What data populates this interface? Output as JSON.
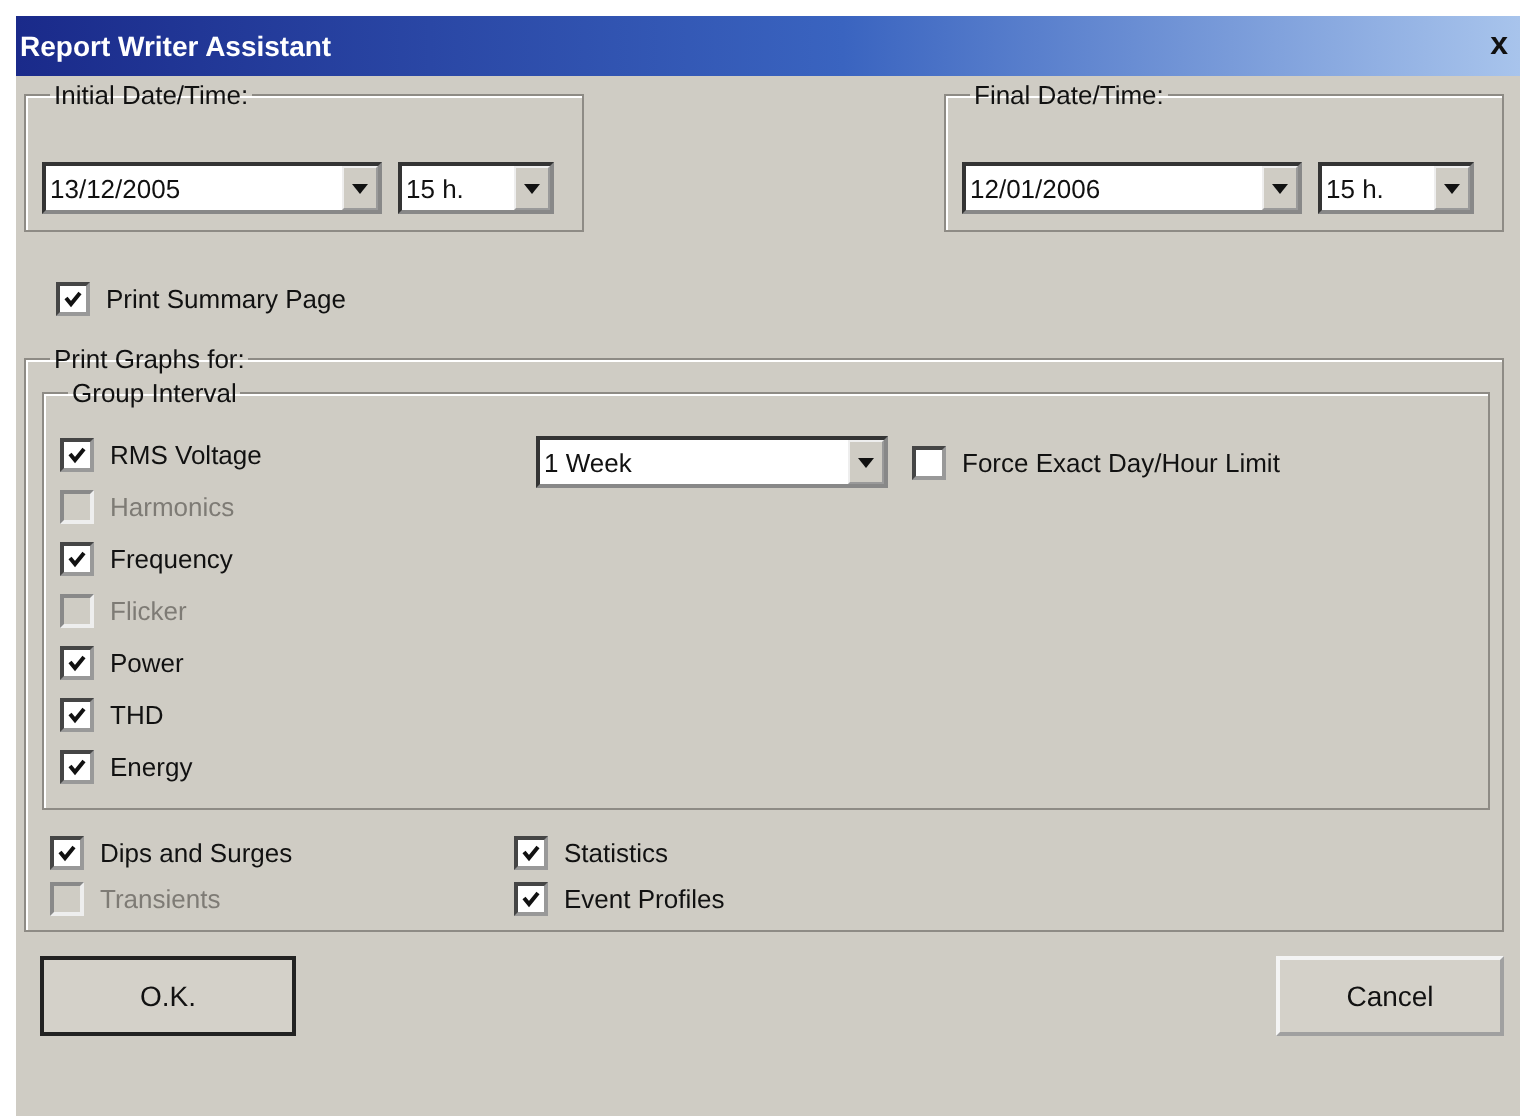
{
  "window": {
    "title": "Report Writer Assistant",
    "close": "x"
  },
  "initial": {
    "label": "Initial Date/Time:",
    "date": "13/12/2005",
    "hour": "15 h."
  },
  "final": {
    "label": "Final Date/Time:",
    "date": "12/01/2006",
    "hour": "15 h."
  },
  "summary": {
    "label": "Print Summary Page",
    "checked": true,
    "disabled": false
  },
  "graphs": {
    "label": "Print Graphs for:",
    "group": {
      "label": "Group Interval",
      "interval": "1 Week",
      "force": {
        "label": "Force Exact Day/Hour Limit",
        "checked": false,
        "disabled": false
      },
      "items": [
        {
          "label": "RMS Voltage",
          "checked": true,
          "disabled": false
        },
        {
          "label": "Harmonics",
          "checked": false,
          "disabled": true
        },
        {
          "label": "Frequency",
          "checked": true,
          "disabled": false
        },
        {
          "label": "Flicker",
          "checked": false,
          "disabled": true
        },
        {
          "label": "Power",
          "checked": true,
          "disabled": false
        },
        {
          "label": "THD",
          "checked": true,
          "disabled": false
        },
        {
          "label": "Energy",
          "checked": true,
          "disabled": false
        }
      ]
    },
    "left": [
      {
        "label": "Dips and Surges",
        "checked": true,
        "disabled": false
      },
      {
        "label": "Transients",
        "checked": false,
        "disabled": true
      }
    ],
    "right": [
      {
        "label": "Statistics",
        "checked": true,
        "disabled": false
      },
      {
        "label": "Event Profiles",
        "checked": true,
        "disabled": false
      }
    ]
  },
  "buttons": [
    {
      "label": "O.K.",
      "default": true
    },
    {
      "label": "Cancel",
      "default": false
    }
  ]
}
